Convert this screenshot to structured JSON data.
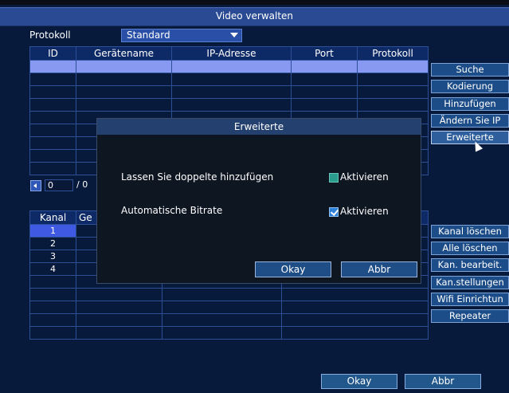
{
  "window": {
    "title": "Video verwalten"
  },
  "protocol": {
    "label": "Protokoll",
    "selected": "Standard"
  },
  "device_table": {
    "headers": [
      "ID",
      "Gerätename",
      "IP-Adresse",
      "Port",
      "Protokoll"
    ]
  },
  "side_buttons": [
    "Suche",
    "Kodierung",
    "Hinzufügen",
    "Ändern Sie IP",
    "Erweiterte"
  ],
  "pager": {
    "current": "0",
    "separator": "/ 0"
  },
  "channel_table": {
    "headers": [
      "Kanal",
      "Ge"
    ],
    "rows": [
      "1",
      "2",
      "3",
      "4"
    ]
  },
  "channel_buttons": [
    "Kanal löschen",
    "Alle löschen",
    "Kan. bearbeit.",
    "Kan.stellungen",
    "Wifi Einrichtun",
    "Repeater"
  ],
  "footer": {
    "ok": "Okay",
    "cancel": "Abbr"
  },
  "dialog": {
    "title": "Erweiterte",
    "option1": {
      "label": "Lassen Sie doppelte hinzufügen",
      "checkbox_label": "Aktivieren",
      "checked": false
    },
    "option2": {
      "label": "Automatische Bitrate",
      "checkbox_label": "Aktivieren",
      "checked": true
    },
    "ok": "Okay",
    "cancel": "Abbr"
  }
}
